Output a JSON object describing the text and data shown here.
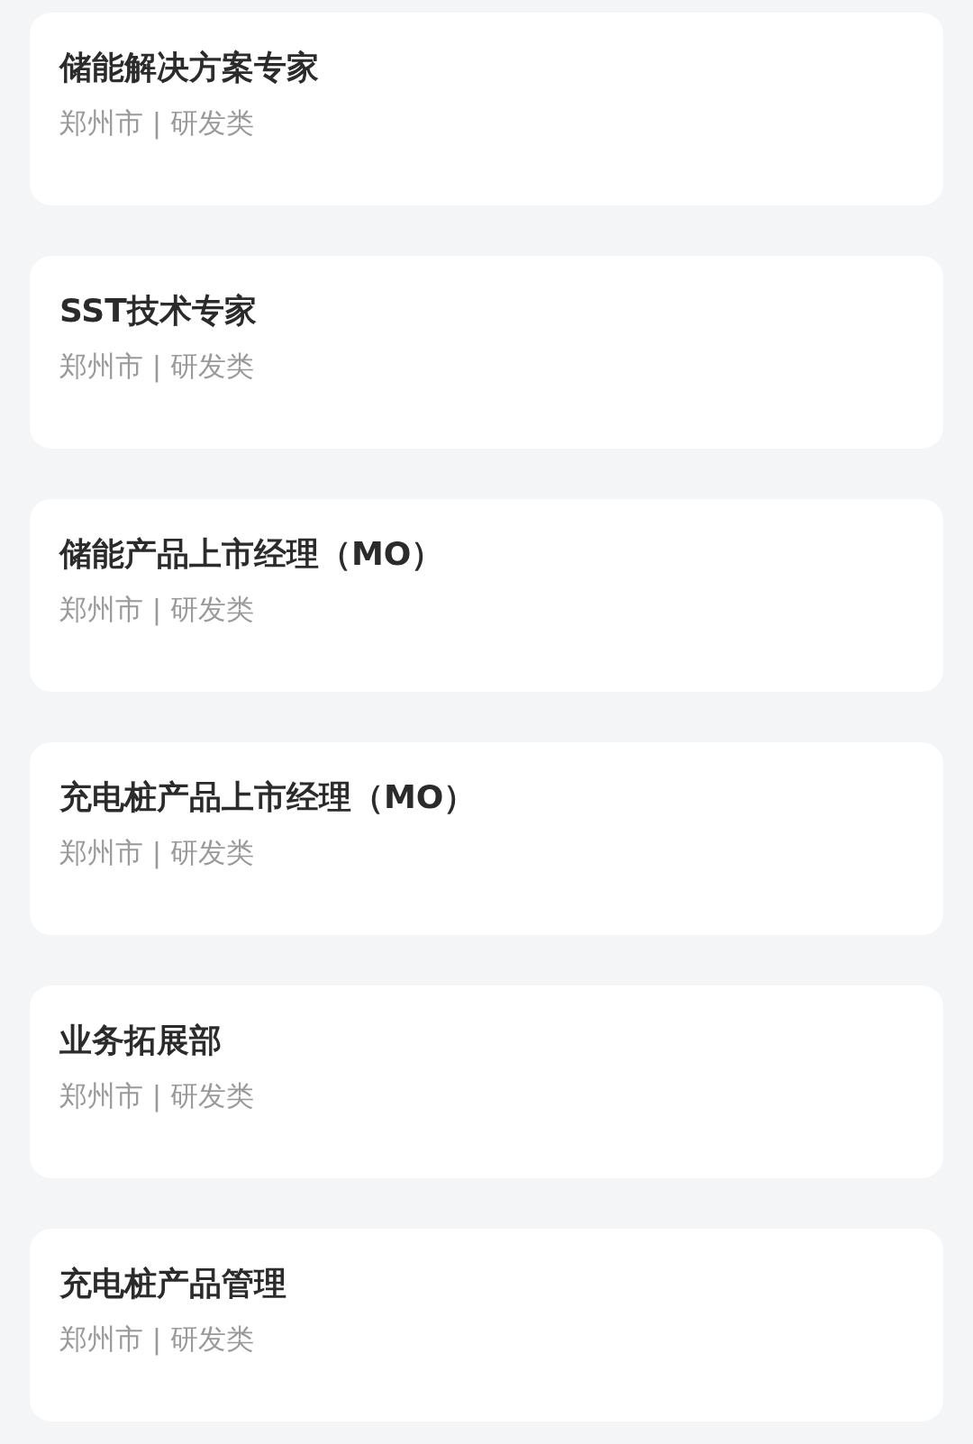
{
  "jobs": [
    {
      "title": "储能解决方案专家",
      "meta": "郑州市 | 研发类"
    },
    {
      "title": "SST技术专家",
      "meta": "郑州市 | 研发类"
    },
    {
      "title": "储能产品上市经理（MO）",
      "meta": "郑州市 | 研发类"
    },
    {
      "title": "充电桩产品上市经理（MO）",
      "meta": "郑州市 | 研发类"
    },
    {
      "title": "业务拓展部",
      "meta": "郑州市 | 研发类"
    },
    {
      "title": "充电桩产品管理",
      "meta": "郑州市 | 研发类"
    }
  ]
}
